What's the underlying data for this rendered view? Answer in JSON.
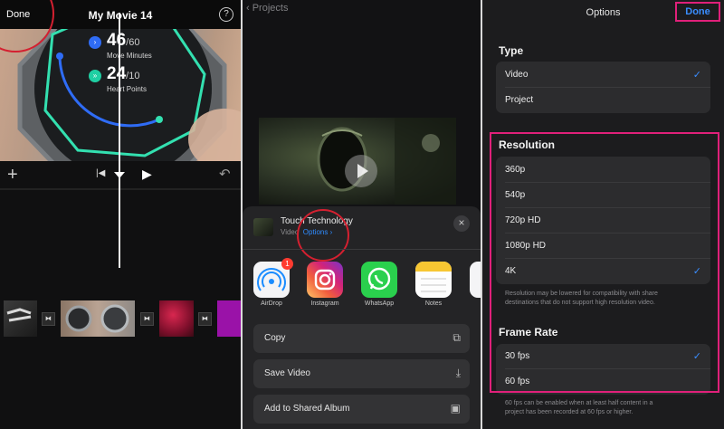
{
  "panel1": {
    "done_label": "Done",
    "title": "My Movie 14",
    "help": "?",
    "stats": {
      "move_value": "46",
      "move_total": "/60",
      "move_label": "Move Minutes",
      "heart_value": "24",
      "heart_total": "/10",
      "heart_label": "Heart Points"
    },
    "toolbar": {
      "add": "+",
      "skip": "|◀",
      "play": "▶",
      "undo": "↶"
    }
  },
  "panel2": {
    "nav_back": "‹ Projects",
    "sheet": {
      "title": "Touch Technology",
      "subtitle": "Video",
      "options_link": "Options ›"
    },
    "apps": [
      {
        "label": "AirDrop",
        "badge": "1"
      },
      {
        "label": "Instagram"
      },
      {
        "label": "WhatsApp"
      },
      {
        "label": "Notes"
      }
    ],
    "actions": [
      {
        "label": "Copy"
      },
      {
        "label": "Save Video"
      },
      {
        "label": "Add to Shared Album"
      }
    ]
  },
  "panel3": {
    "title": "Options",
    "done_label": "Done",
    "type": {
      "heading": "Type",
      "options": [
        "Video",
        "Project"
      ],
      "selected": "Video"
    },
    "resolution": {
      "heading": "Resolution",
      "options": [
        "360p",
        "540p",
        "720p HD",
        "1080p HD",
        "4K"
      ],
      "selected": "4K",
      "note_line1": "Resolution may be lowered for compatibility with share",
      "note_line2": "destinations that do not support high resolution video."
    },
    "frame_rate": {
      "heading": "Frame Rate",
      "options": [
        "30 fps",
        "60 fps"
      ],
      "selected": "30 fps",
      "note_line1": "60 fps can be enabled when at least half content in a",
      "note_line2": "project has been recorded at 60 fps or higher."
    },
    "checkmark": "✓"
  },
  "colors": {
    "accent_blue": "#3a8dff",
    "highlight_pink": "#e0207a",
    "annotation_red": "#d42030"
  }
}
